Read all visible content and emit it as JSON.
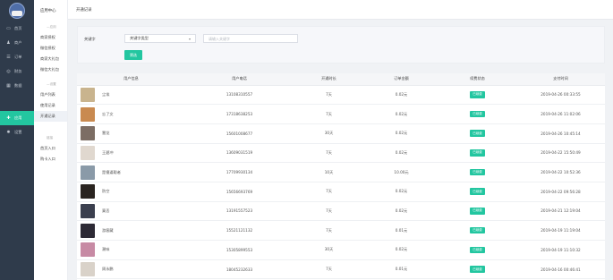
{
  "rail": {
    "items": [
      {
        "label": "首页",
        "icon": "monitor-icon",
        "glyph": "▭",
        "active": false
      },
      {
        "label": "商户",
        "icon": "users-icon",
        "glyph": "♟",
        "active": false
      },
      {
        "label": "订单",
        "icon": "list-icon",
        "glyph": "☰",
        "active": false
      },
      {
        "label": "财务",
        "icon": "wallet-icon",
        "glyph": "◎",
        "active": false
      },
      {
        "label": "数据",
        "icon": "chart-icon",
        "glyph": "▦",
        "active": false
      },
      {
        "label": "应用",
        "icon": "apps-icon",
        "glyph": "✚",
        "active": true
      },
      {
        "label": "设置",
        "icon": "gear-icon",
        "glyph": "✹",
        "active": false
      }
    ]
  },
  "submenu": {
    "title": "应用中心",
    "group1": "—应用",
    "group1_items": [
      "商家授权",
      "微信授权",
      "商家大礼包",
      "微信大礼包"
    ],
    "group2": "—设置",
    "group2_items": [
      "用户列表",
      "使用记录",
      "开通记录"
    ],
    "group3": "链接",
    "group3_items": [
      "首页入口",
      "购卡入口"
    ]
  },
  "topbar": {
    "tab": "开通记录"
  },
  "filter": {
    "label": "关键字",
    "select_value": "关键字类型",
    "input_placeholder": "请输入关键字",
    "search_button": "筛选"
  },
  "table": {
    "headers": [
      "用户信息",
      "用户电话",
      "开通时长",
      "订单金额",
      "续费状态",
      "支付时间"
    ],
    "rows": [
      {
        "name": "尘埃",
        "phone": "13108310557",
        "duration": "7天",
        "amount": "0.02元",
        "status": "已续费",
        "time": "2019-04-26 00:33:55",
        "avatar": "#c9b48e"
      },
      {
        "name": "忘了文",
        "phone": "17318638253",
        "duration": "7天",
        "amount": "0.02元",
        "status": "已续费",
        "time": "2019-04-26 11:02:06",
        "avatar": "#c98a50"
      },
      {
        "name": "慧龙",
        "phone": "15601008677",
        "duration": "30天",
        "amount": "0.02元",
        "status": "已续费",
        "time": "2019-04-26 10:45:14",
        "avatar": "#7c6d64"
      },
      {
        "name": "王碧冲",
        "phone": "13609031519",
        "duration": "7天",
        "amount": "0.02元",
        "status": "已续费",
        "time": "2019-04-22 15:50:49",
        "avatar": "#e0d8cf"
      },
      {
        "name": "是傻逼聪者",
        "phone": "17709930134",
        "duration": "10天",
        "amount": "10.00元",
        "status": "已续费",
        "time": "2019-04-22 10:52:36",
        "avatar": "#8a9aa8"
      },
      {
        "name": "防空",
        "phone": "15656693769",
        "duration": "7天",
        "amount": "0.02元",
        "status": "已续费",
        "time": "2019-04-22 09:56:28",
        "avatar": "#2a2420"
      },
      {
        "name": "寞丢",
        "phone": "13191557523",
        "duration": "7天",
        "amount": "0.02元",
        "status": "已续费",
        "time": "2019-04-21 12:19:04",
        "avatar": "#3b3f4e"
      },
      {
        "name": "游客藏",
        "phone": "15521121132",
        "duration": "7天",
        "amount": "0.01元",
        "status": "已续费",
        "time": "2019-04-19 11:19:04",
        "avatar": "#2d2a35"
      },
      {
        "name": "潮味",
        "phone": "15305899553",
        "duration": "30天",
        "amount": "0.02元",
        "status": "已续费",
        "time": "2019-04-19 11:10:32",
        "avatar": "#c78aa4"
      },
      {
        "name": "周永鹏",
        "phone": "18045232633",
        "duration": "7天",
        "amount": "0.01元",
        "status": "已续费",
        "time": "2019-04-16 00:46:41",
        "avatar": "#d9d2c9"
      }
    ]
  },
  "colors": {
    "accent": "#23c6a0",
    "rail": "#2f3b4b"
  }
}
